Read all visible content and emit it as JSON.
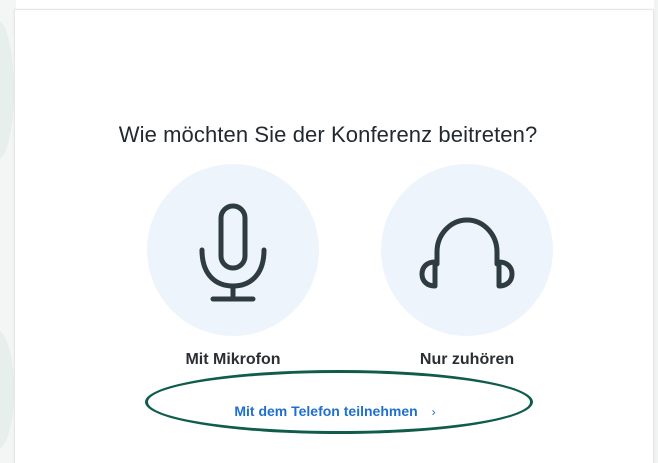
{
  "dialog": {
    "title": "Wie möchten Sie der Konferenz beitreten?",
    "options": [
      {
        "label": "Mit Mikrofon",
        "icon": "microphone-icon"
      },
      {
        "label": "Nur zuhören",
        "icon": "headphones-icon"
      }
    ],
    "phone_link": {
      "label": "Mit dem Telefon teilnehmen",
      "chevron": "›"
    }
  },
  "colors": {
    "icon_stroke": "#2f3b43",
    "circle_bg": "#eef4fb",
    "link": "#1f6fd1",
    "annotation": "#0f5b4c"
  }
}
